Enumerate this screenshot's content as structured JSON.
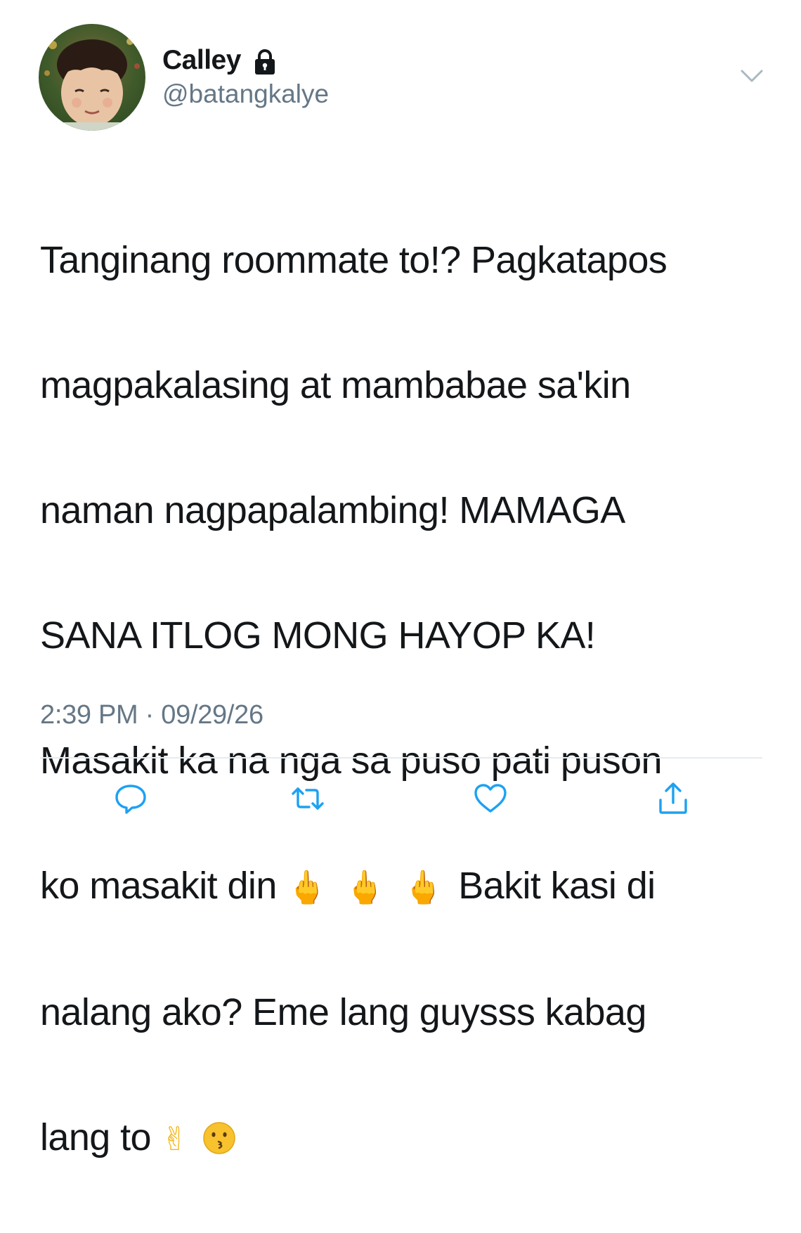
{
  "user": {
    "display_name": "Calley",
    "handle": "@batangkalye",
    "lock_icon": "lock-icon",
    "avatar_icon": "avatar-photo"
  },
  "tweet": {
    "lines": [
      "Tanginang roommate to!? Pagkatapos",
      "magpakalasing at mambabae sa'kin",
      "naman nagpapalambing! MAMAGA",
      "SANA ITLOG MONG HAYOP KA!",
      "Masakit ka na nga sa puso pati puson",
      "ko masakit din",
      "Bakit kasi di",
      "nalang ako? Eme lang guysss kabag",
      "lang to"
    ],
    "emojis": {
      "middle_finger": "🖕",
      "victory_hand": "✌",
      "kissing_face": "kissing-face-icon"
    }
  },
  "meta": {
    "timestamp": "2:39 PM · 09/29/26"
  },
  "actions": {
    "reply_icon": "reply-icon",
    "retweet_icon": "retweet-icon",
    "like_icon": "heart-icon",
    "share_icon": "share-icon",
    "menu_icon": "chevron-down-icon"
  },
  "colors": {
    "text": "#14171a",
    "secondary": "#657786",
    "icon": "#1da1f2",
    "divider": "#e6ecf0"
  }
}
